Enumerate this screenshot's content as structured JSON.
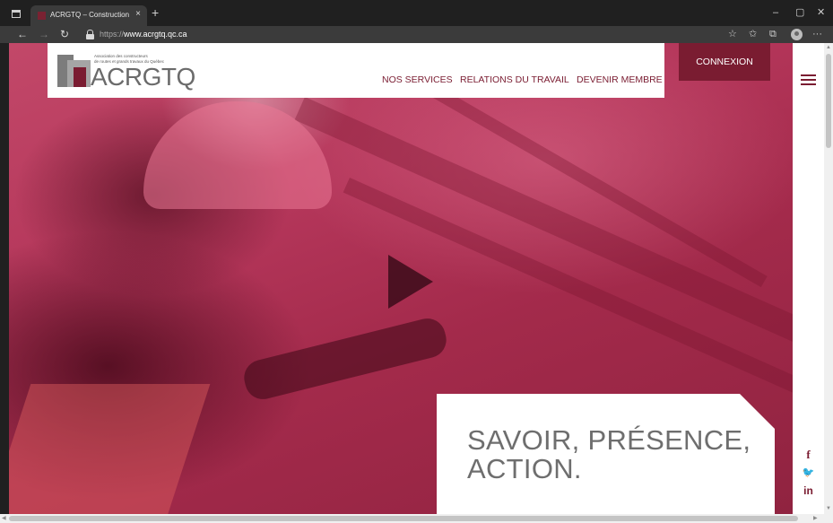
{
  "browser": {
    "tab_title": "ACRGTQ – Construction, génie c",
    "tab_close": "×",
    "new_tab": "+",
    "url_protocol": "https://",
    "url_host": "www.acrgtq.qc.ca",
    "controls": {
      "minimize": "–",
      "maximize": "▢",
      "close": "✕"
    },
    "nav": {
      "back": "←",
      "forward": "→",
      "refresh": "↻"
    },
    "toolbar": {
      "read_aloud": "☆",
      "favorites": "✩",
      "collections": "⧉",
      "more": "···"
    }
  },
  "site": {
    "logo": {
      "tagline": "Association des constructeurs\nde routes et grands travaux du Québec",
      "wordmark": "ACRGTQ"
    },
    "nav": [
      "NOS SERVICES",
      "RELATIONS DU TRAVAIL",
      "DEVENIR MEMBRE"
    ],
    "login_label": "CONNEXION",
    "slogan": [
      "SAVOIR, PRÉSENCE,",
      "ACTION."
    ],
    "social": {
      "facebook": "f",
      "twitter": "🐦",
      "linkedin": "in"
    }
  },
  "colors": {
    "brand": "#7a1c31",
    "hero_tint": "#b4365a",
    "slogan_text": "#6e6e6e"
  },
  "icons": [
    "window-icon",
    "favicon-icon",
    "lock-icon",
    "play-icon",
    "hamburger-icon",
    "facebook-icon",
    "twitter-icon",
    "linkedin-icon"
  ]
}
